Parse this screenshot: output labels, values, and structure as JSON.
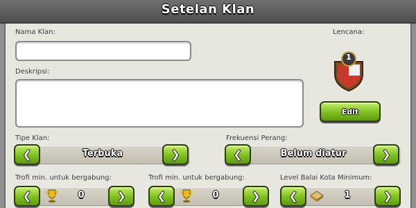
{
  "header": {
    "title": "Setelan Klan"
  },
  "form": {
    "name_label": "Nama Klan:",
    "name_value": "",
    "description_label": "Deskripsi:",
    "description_value": "",
    "badge_label": "Lencana:",
    "badge_level": "1",
    "edit_label": "Edit"
  },
  "clan_type": {
    "label": "Tipe Klan:",
    "value": "Terbuka",
    "prev_label": "❮",
    "next_label": "❯"
  },
  "war_frequency": {
    "label": "Frekuensi Perang:",
    "value": "Belum diatur",
    "prev_label": "❮",
    "next_label": "❯"
  },
  "min_trophies_1": {
    "label": "Trofi min. untuk bergabung:",
    "value": "0",
    "icon": "trophy-icon",
    "prev_label": "❮",
    "next_label": "❯"
  },
  "min_trophies_2": {
    "label": "Trofi min. untuk bergabung:",
    "value": "0",
    "icon": "trophy-icon",
    "prev_label": "❮",
    "next_label": "❯"
  },
  "min_town_hall": {
    "label": "Level Balai Kota Minimum:",
    "value": "1",
    "icon": "town-hall-icon",
    "prev_label": "❮",
    "next_label": "❯"
  },
  "colors": {
    "green_button": "#7dbf1f",
    "panel": "#e7e6df",
    "header": "#5e5e5e",
    "badge_red": "#c9392b"
  }
}
